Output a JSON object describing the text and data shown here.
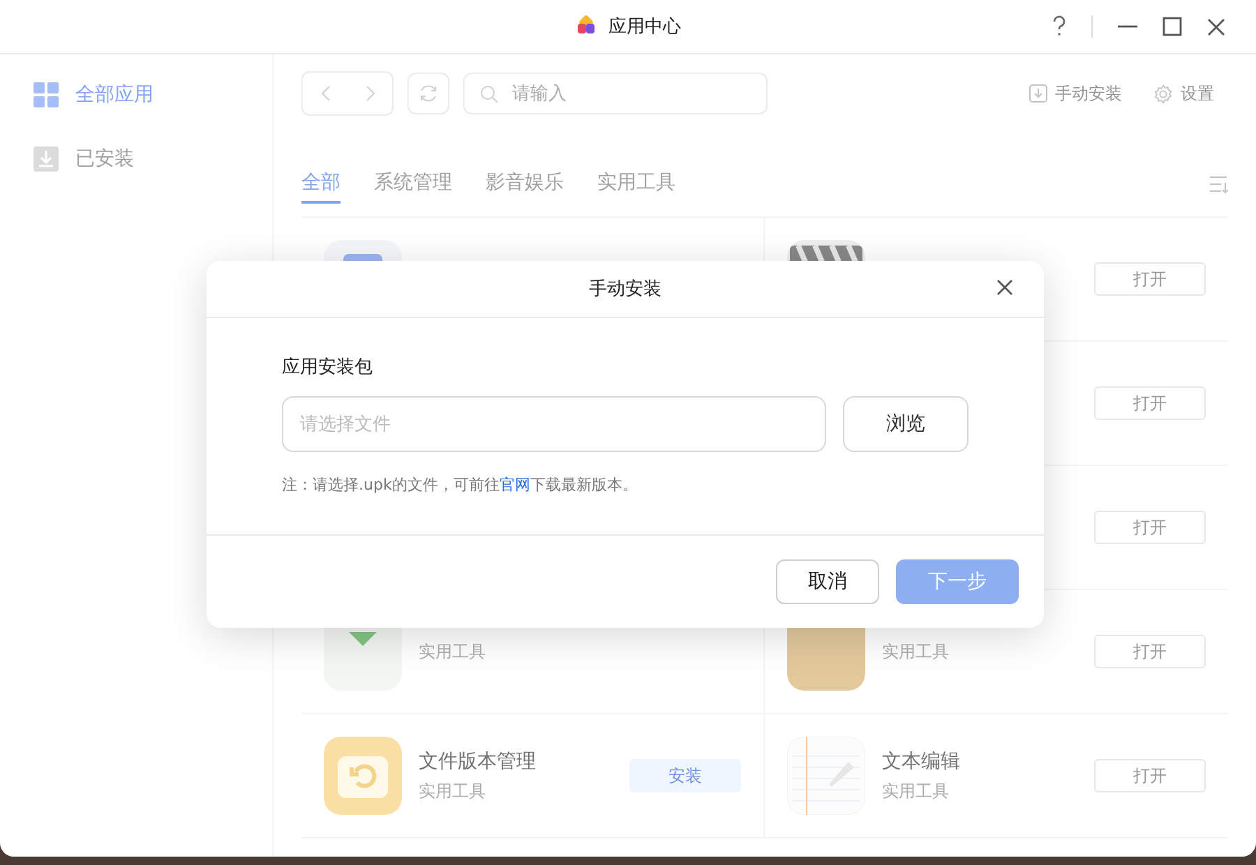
{
  "window": {
    "title": "应用中心"
  },
  "sidebar": {
    "items": [
      {
        "label": "全部应用",
        "selected": true
      },
      {
        "label": "已安装",
        "selected": false
      }
    ]
  },
  "toolbar": {
    "search": {
      "placeholder": "请输入"
    },
    "actions": [
      {
        "label": "手动安装"
      },
      {
        "label": "设置"
      }
    ]
  },
  "tabs": [
    {
      "label": "全部",
      "selected": true
    },
    {
      "label": "系统管理",
      "selected": false
    },
    {
      "label": "影音娱乐",
      "selected": false
    },
    {
      "label": "实用工具",
      "selected": false
    }
  ],
  "app_rows": [
    {
      "cells": [
        {},
        {
          "action": {
            "label": "打开",
            "kind": "open"
          }
        }
      ]
    },
    {
      "cells": [
        {},
        {
          "action": {
            "label": "打开",
            "kind": "open"
          }
        }
      ]
    },
    {
      "cells": [
        {},
        {
          "action": {
            "label": "打开",
            "kind": "open"
          }
        }
      ]
    },
    {
      "cells": [
        {
          "category": "实用工具"
        },
        {
          "category": "实用工具",
          "action": {
            "label": "打开",
            "kind": "open"
          }
        }
      ]
    },
    {
      "cells": [
        {
          "name": "文件版本管理",
          "category": "实用工具",
          "action": {
            "label": "安装",
            "kind": "install"
          }
        },
        {
          "name": "文本编辑",
          "category": "实用工具",
          "action": {
            "label": "打开",
            "kind": "open"
          }
        }
      ]
    }
  ],
  "dialog": {
    "title": "手动安装",
    "field_label": "应用安装包",
    "file_field": {
      "placeholder": "请选择文件"
    },
    "browse_button": "浏览",
    "note": {
      "before": "注：请选择.upk的文件，可前往",
      "link": "官网",
      "after": "下载最新版本。"
    },
    "buttons": [
      {
        "label": "取消",
        "kind": "secondary",
        "disabled": false
      },
      {
        "label": "下一步",
        "kind": "primary",
        "disabled": true
      }
    ]
  }
}
